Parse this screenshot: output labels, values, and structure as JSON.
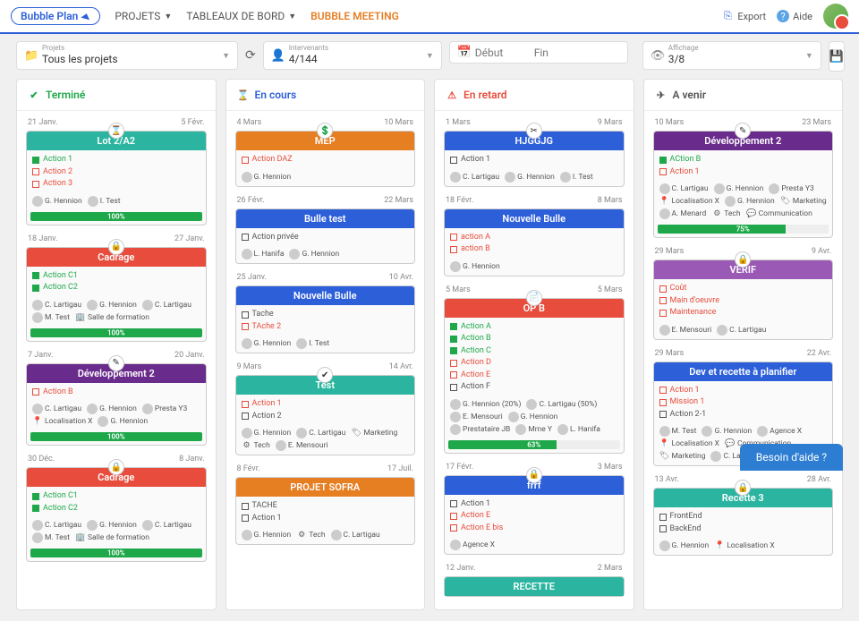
{
  "nav": {
    "logo": "Bubble Plan",
    "projects": "PROJETS",
    "dashboards": "TABLEAUX DE BORD",
    "meeting": "BUBBLE MEETING",
    "export": "Export",
    "help": "Aide"
  },
  "filters": {
    "projects": {
      "label": "Projets",
      "value": "Tous les projets"
    },
    "people": {
      "label": "Intervenants",
      "value": "4/144"
    },
    "date_start": {
      "placeholder": "Début"
    },
    "date_end": {
      "placeholder": "Fin"
    },
    "display": {
      "label": "Affichage",
      "value": "3/8"
    }
  },
  "columns": [
    {
      "key": "done",
      "title": "Terminé",
      "icon": "✔",
      "color": "#1FA84A"
    },
    {
      "key": "progress",
      "title": "En cours",
      "icon": "⌛",
      "color": "#2D5FD9"
    },
    {
      "key": "late",
      "title": "En retard",
      "icon": "⚠",
      "color": "#E74C3C"
    },
    {
      "key": "todo",
      "title": "A venir",
      "icon": "✈",
      "color": "#555"
    }
  ],
  "cards": {
    "done": [
      {
        "title": "Lot 2/A2",
        "bg": "#2BB5A0",
        "d1": "21 Janv.",
        "d2": "5 Févr.",
        "ico": "⌛",
        "actions": [
          {
            "t": "Action 1",
            "s": "done"
          },
          {
            "t": "Action 2",
            "s": "late"
          },
          {
            "t": "Action 3",
            "s": "late"
          }
        ],
        "people": [
          {
            "n": "G. Hennion",
            "a": true
          },
          {
            "n": "I. Test",
            "a": true
          }
        ],
        "prog": 100
      },
      {
        "title": "Cadrage",
        "bg": "#E74C3C",
        "d1": "18 Janv.",
        "d2": "27 Janv.",
        "ico": "🔒",
        "actions": [
          {
            "t": "Action C1",
            "s": "done"
          },
          {
            "t": "Action C2",
            "s": "done"
          }
        ],
        "people": [
          {
            "n": "C. Lartigau",
            "a": true
          },
          {
            "n": "G. Hennion",
            "a": true
          },
          {
            "n": "C. Lartigau",
            "a": true
          },
          {
            "n": "M. Test",
            "a": true
          },
          {
            "n": "Salle de formation",
            "i": "🏢"
          }
        ],
        "prog": 100
      },
      {
        "title": "Développement 2",
        "bg": "#6A2C8C",
        "d1": "7 Janv.",
        "d2": "20 Janv.",
        "ico": "✎",
        "actions": [
          {
            "t": "Action B",
            "s": "late"
          }
        ],
        "people": [
          {
            "n": "C. Lartigau",
            "a": true
          },
          {
            "n": "G. Hennion",
            "a": true
          },
          {
            "n": "Presta Y3",
            "a": true
          },
          {
            "n": "Localisation X",
            "i": "📍"
          },
          {
            "n": "G. Hennion",
            "a": true
          }
        ],
        "prog": 100
      },
      {
        "title": "Cadrage",
        "bg": "#E74C3C",
        "d1": "30 Déc.",
        "d2": "8 Janv.",
        "ico": "🔒",
        "actions": [
          {
            "t": "Action C1",
            "s": "done"
          },
          {
            "t": "Action C2",
            "s": "done"
          }
        ],
        "people": [
          {
            "n": "C. Lartigau",
            "a": true
          },
          {
            "n": "G. Hennion",
            "a": true
          },
          {
            "n": "C. Lartigau",
            "a": true
          },
          {
            "n": "M. Test",
            "a": true
          },
          {
            "n": "Salle de formation",
            "i": "🏢"
          }
        ],
        "prog": 100
      }
    ],
    "progress": [
      {
        "title": "MEP",
        "bg": "#E67E22",
        "d1": "4 Mars",
        "d2": "10 Mars",
        "ico": "💲",
        "actions": [
          {
            "t": "Action DAZ",
            "s": "late"
          }
        ],
        "people": [
          {
            "n": "G. Hennion",
            "a": true
          }
        ]
      },
      {
        "title": "Bulle test",
        "bg": "#2D5FD9",
        "d1": "26 Févr.",
        "d2": "22 Mars",
        "ico": "",
        "actions": [
          {
            "t": "Action privée",
            "s": "norm"
          }
        ],
        "people": [
          {
            "n": "L. Hanifa",
            "a": true
          },
          {
            "n": "G. Hennion",
            "a": true
          }
        ]
      },
      {
        "title": "Nouvelle Bulle",
        "bg": "#2D5FD9",
        "d1": "25 Janv.",
        "d2": "10 Avr.",
        "ico": "",
        "actions": [
          {
            "t": "Tache",
            "s": "norm"
          },
          {
            "t": "TAche 2",
            "s": "late"
          }
        ],
        "people": [
          {
            "n": "G. Hennion",
            "a": true
          },
          {
            "n": "I. Test",
            "a": true
          }
        ]
      },
      {
        "title": "Test",
        "bg": "#2BB5A0",
        "d1": "9 Mars",
        "d2": "14 Avr.",
        "ico": "✔",
        "actions": [
          {
            "t": "Action 1",
            "s": "late"
          },
          {
            "t": "Action 2",
            "s": "norm"
          }
        ],
        "people": [
          {
            "n": "G. Hennion",
            "a": true
          },
          {
            "n": "C. Lartigau",
            "a": true
          },
          {
            "n": "Marketing",
            "i": "🏷"
          },
          {
            "n": "Tech",
            "i": "⚙"
          },
          {
            "n": "E. Mensouri",
            "a": true
          }
        ]
      },
      {
        "title": "PROJET SOFRA",
        "bg": "#E67E22",
        "d1": "8 Févr.",
        "d2": "17 Juil.",
        "ico": "",
        "actions": [
          {
            "t": "TACHE",
            "s": "norm"
          },
          {
            "t": "Action 1",
            "s": "norm"
          }
        ],
        "people": [
          {
            "n": "G. Hennion",
            "a": true
          },
          {
            "n": "Tech",
            "i": "⚙"
          },
          {
            "n": "C. Lartigau",
            "a": true
          }
        ]
      }
    ],
    "late": [
      {
        "title": "HJGGJG",
        "bg": "#2D5FD9",
        "d1": "1 Mars",
        "d2": "9 Mars",
        "ico": "✂",
        "actions": [
          {
            "t": "Action 1",
            "s": "norm"
          }
        ],
        "people": [
          {
            "n": "C. Lartigau",
            "a": true
          },
          {
            "n": "G. Hennion",
            "a": true
          },
          {
            "n": "I. Test",
            "a": true
          }
        ]
      },
      {
        "title": "Nouvelle Bulle",
        "bg": "#2D5FD9",
        "d1": "18 Févr.",
        "d2": "8 Mars",
        "ico": "",
        "actions": [
          {
            "t": "action A",
            "s": "late"
          },
          {
            "t": "action B",
            "s": "late"
          }
        ],
        "people": [
          {
            "n": "G. Hennion",
            "a": true
          }
        ]
      },
      {
        "title": "OP B",
        "bg": "#E74C3C",
        "d1": "5 Mars",
        "d2": "5 Mars",
        "ico": "📄",
        "actions": [
          {
            "t": "Action A",
            "s": "done"
          },
          {
            "t": "Action B",
            "s": "done"
          },
          {
            "t": "Action C",
            "s": "done"
          },
          {
            "t": "Action D",
            "s": "late"
          },
          {
            "t": "Action E",
            "s": "late"
          },
          {
            "t": "Action F",
            "s": "norm"
          }
        ],
        "people": [
          {
            "n": "G. Hennion (20%)",
            "a": true
          },
          {
            "n": "C. Lartigau (50%)",
            "a": true
          },
          {
            "n": "E. Mensouri",
            "a": true
          },
          {
            "n": "G. Hennion",
            "a": true
          },
          {
            "n": "Prestataire JB",
            "a": true
          },
          {
            "n": "Mme Y",
            "a": true
          },
          {
            "n": "L. Hanifa",
            "a": true
          }
        ],
        "prog": 63
      },
      {
        "title": "frrf",
        "bg": "#2D5FD9",
        "d1": "17 Févr.",
        "d2": "3 Mars",
        "ico": "🔒",
        "actions": [
          {
            "t": "Action 1",
            "s": "norm"
          },
          {
            "t": "Action E",
            "s": "late"
          },
          {
            "t": "Action E bis",
            "s": "late"
          }
        ],
        "people": [
          {
            "n": "Agence X",
            "a": true
          }
        ]
      },
      {
        "title": "RECETTE",
        "bg": "#2BB5A0",
        "d1": "12 Janv.",
        "d2": "2 Mars",
        "ico": ""
      }
    ],
    "todo": [
      {
        "title": "Développement 2",
        "bg": "#6A2C8C",
        "d1": "10 Mars",
        "d2": "23 Mars",
        "ico": "✎",
        "actions": [
          {
            "t": "ACtion B",
            "s": "done"
          },
          {
            "t": "Action 1",
            "s": "late"
          }
        ],
        "people": [
          {
            "n": "C. Lartigau",
            "a": true
          },
          {
            "n": "G. Hennion",
            "a": true
          },
          {
            "n": "Presta Y3",
            "a": true
          },
          {
            "n": "Localisation X",
            "i": "📍"
          },
          {
            "n": "G. Hennion",
            "a": true
          },
          {
            "n": "Marketing",
            "i": "🏷"
          },
          {
            "n": "A. Menard",
            "a": true
          },
          {
            "n": "Tech",
            "i": "⚙"
          },
          {
            "n": "Communication",
            "i": "💬"
          }
        ],
        "prog": 75
      },
      {
        "title": "VERIF",
        "bg": "#9B59B6",
        "d1": "29 Mars",
        "d2": "9 Avr.",
        "ico": "🔒",
        "actions": [
          {
            "t": "Coût",
            "s": "late"
          },
          {
            "t": "Main d'oeuvre",
            "s": "late"
          },
          {
            "t": "Maintenance",
            "s": "late"
          }
        ],
        "people": [
          {
            "n": "E. Mensouri",
            "a": true
          },
          {
            "n": "C. Lartigau",
            "a": true
          }
        ]
      },
      {
        "title": "Dev et recette à planifier",
        "bg": "#2D5FD9",
        "d1": "29 Mars",
        "d2": "22 Avr.",
        "ico": "",
        "actions": [
          {
            "t": "Action 1",
            "s": "late"
          },
          {
            "t": "Mission 1",
            "s": "late"
          },
          {
            "t": "Action 2-1",
            "s": "norm"
          }
        ],
        "people": [
          {
            "n": "M. Test",
            "a": true
          },
          {
            "n": "G. Hennion",
            "a": true
          },
          {
            "n": "Agence X",
            "a": true
          },
          {
            "n": "Localisation X",
            "i": "📍"
          },
          {
            "n": "Communication",
            "i": "💬"
          },
          {
            "n": "Marketing",
            "i": "🏷"
          },
          {
            "n": "C. Lartigau",
            "a": true
          }
        ]
      },
      {
        "title": "Recette 3",
        "bg": "#2BB5A0",
        "d1": "13 Avr.",
        "d2": "28 Avr.",
        "ico": "🔒",
        "actions": [
          {
            "t": "FrontEnd",
            "s": "norm"
          },
          {
            "t": "BackEnd",
            "s": "norm"
          }
        ],
        "people": [
          {
            "n": "G. Hennion",
            "a": true
          },
          {
            "n": "Localisation X",
            "i": "📍"
          }
        ]
      }
    ]
  },
  "help_bubble": "Besoin d'aide ?"
}
